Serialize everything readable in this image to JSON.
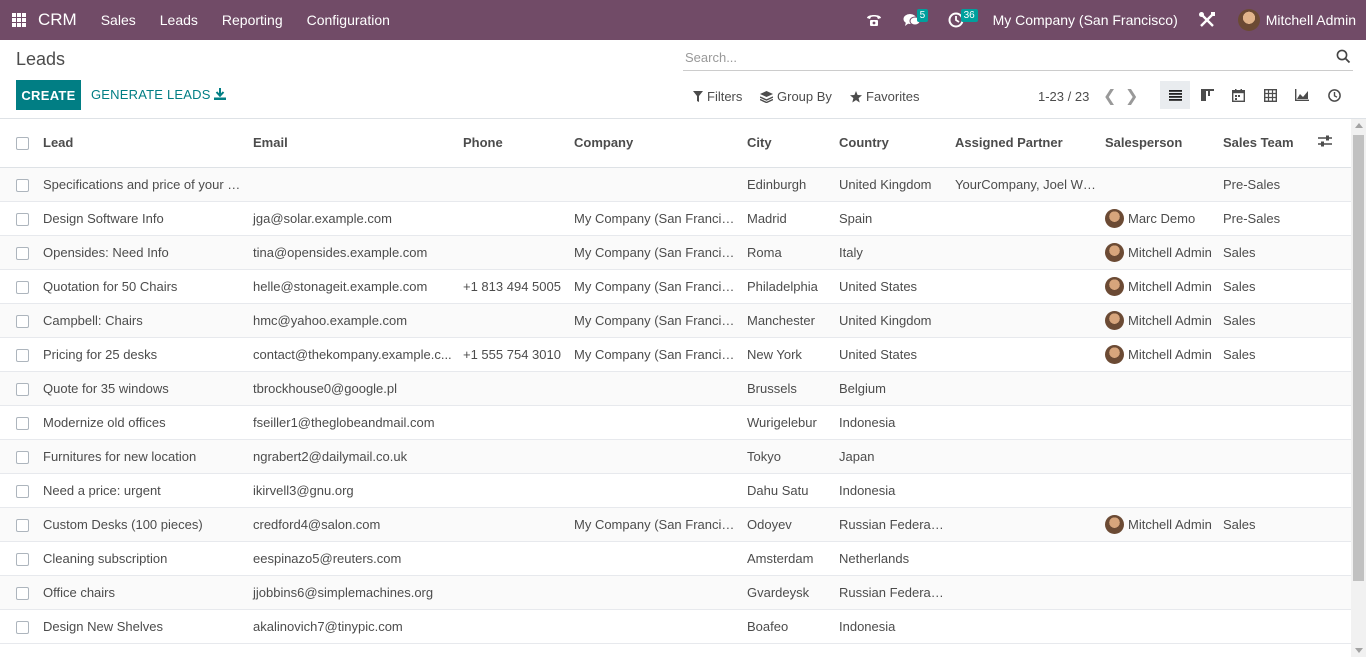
{
  "navbar": {
    "brand": "CRM",
    "menu": [
      "Sales",
      "Leads",
      "Reporting",
      "Configuration"
    ],
    "messages_count": "5",
    "activities_count": "36",
    "company": "My Company (San Francisco)",
    "user": "Mitchell Admin"
  },
  "control_panel": {
    "title": "Leads",
    "search_placeholder": "Search...",
    "create_label": "CREATE",
    "generate_label": "GENERATE LEADS",
    "filters_label": "Filters",
    "groupby_label": "Group By",
    "favorites_label": "Favorites",
    "pager": "1-23 / 23"
  },
  "table": {
    "columns": [
      "Lead",
      "Email",
      "Phone",
      "Company",
      "City",
      "Country",
      "Assigned Partner",
      "Salesperson",
      "Sales Team"
    ],
    "rows": [
      {
        "lead": "Specifications and price of your p...",
        "email": "",
        "phone": "",
        "company": "",
        "city": "Edinburgh",
        "country": "United Kingdom",
        "partner": "YourCompany, Joel Willis",
        "salesperson": "",
        "team": "Pre-Sales"
      },
      {
        "lead": "Design Software Info",
        "email": "jga@solar.example.com",
        "phone": "",
        "company": "My Company (San Francisco)",
        "city": "Madrid",
        "country": "Spain",
        "partner": "",
        "salesperson": "Marc Demo",
        "team": "Pre-Sales"
      },
      {
        "lead": "Opensides: Need Info",
        "email": "tina@opensides.example.com",
        "phone": "",
        "company": "My Company (San Francisco)",
        "city": "Roma",
        "country": "Italy",
        "partner": "",
        "salesperson": "Mitchell Admin",
        "team": "Sales"
      },
      {
        "lead": "Quotation for 50 Chairs",
        "email": "helle@stonageit.example.com",
        "phone": "+1 813 494 5005",
        "company": "My Company (San Francisco)",
        "city": "Philadelphia",
        "country": "United States",
        "partner": "",
        "salesperson": "Mitchell Admin",
        "team": "Sales"
      },
      {
        "lead": "Campbell: Chairs",
        "email": "hmc@yahoo.example.com",
        "phone": "",
        "company": "My Company (San Francisco)",
        "city": "Manchester",
        "country": "United Kingdom",
        "partner": "",
        "salesperson": "Mitchell Admin",
        "team": "Sales"
      },
      {
        "lead": "Pricing for 25 desks",
        "email": "contact@thekompany.example.c...",
        "phone": "+1 555 754 3010",
        "company": "My Company (San Francisco)",
        "city": "New York",
        "country": "United States",
        "partner": "",
        "salesperson": "Mitchell Admin",
        "team": "Sales"
      },
      {
        "lead": "Quote for 35 windows",
        "email": "tbrockhouse0@google.pl",
        "phone": "",
        "company": "",
        "city": "Brussels",
        "country": "Belgium",
        "partner": "",
        "salesperson": "",
        "team": ""
      },
      {
        "lead": "Modernize old offices",
        "email": "fseiller1@theglobeandmail.com",
        "phone": "",
        "company": "",
        "city": "Wurigelebur",
        "country": "Indonesia",
        "partner": "",
        "salesperson": "",
        "team": ""
      },
      {
        "lead": "Furnitures for new location",
        "email": "ngrabert2@dailymail.co.uk",
        "phone": "",
        "company": "",
        "city": "Tokyo",
        "country": "Japan",
        "partner": "",
        "salesperson": "",
        "team": ""
      },
      {
        "lead": "Need a price: urgent",
        "email": "ikirvell3@gnu.org",
        "phone": "",
        "company": "",
        "city": "Dahu Satu",
        "country": "Indonesia",
        "partner": "",
        "salesperson": "",
        "team": ""
      },
      {
        "lead": "Custom Desks (100 pieces)",
        "email": "credford4@salon.com",
        "phone": "",
        "company": "My Company (San Francisco)",
        "city": "Odoyev",
        "country": "Russian Federation",
        "partner": "",
        "salesperson": "Mitchell Admin",
        "team": "Sales"
      },
      {
        "lead": "Cleaning subscription",
        "email": "eespinazo5@reuters.com",
        "phone": "",
        "company": "",
        "city": "Amsterdam",
        "country": "Netherlands",
        "partner": "",
        "salesperson": "",
        "team": ""
      },
      {
        "lead": "Office chairs",
        "email": "jjobbins6@simplemachines.org",
        "phone": "",
        "company": "",
        "city": "Gvardeysk",
        "country": "Russian Federation",
        "partner": "",
        "salesperson": "",
        "team": ""
      },
      {
        "lead": "Design New Shelves",
        "email": "akalinovich7@tinypic.com",
        "phone": "",
        "company": "",
        "city": "Boafeo",
        "country": "Indonesia",
        "partner": "",
        "salesperson": "",
        "team": ""
      }
    ]
  },
  "colors": {
    "navbar": "#714b67",
    "primary": "#017e84",
    "badge": "#00a09d"
  }
}
